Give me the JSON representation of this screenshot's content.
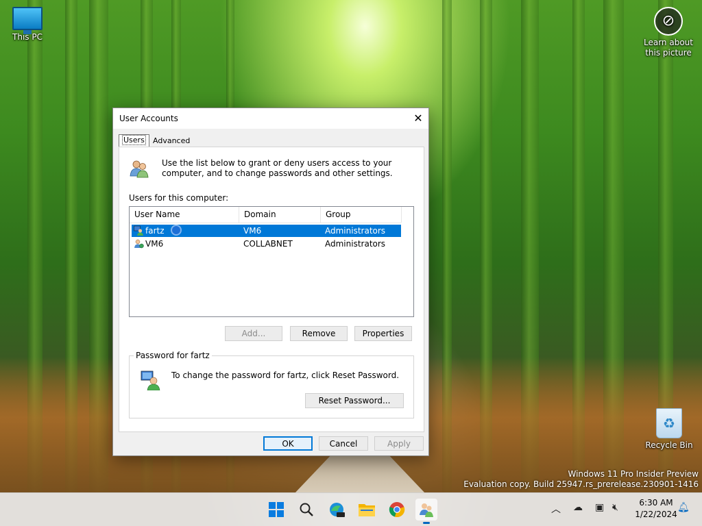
{
  "desktop": {
    "icons": [
      {
        "label": "This PC"
      },
      {
        "label": "Learn about this picture"
      },
      {
        "label": "Recycle Bin"
      }
    ],
    "watermark": {
      "line1": "Windows 11 Pro Insider Preview",
      "line2": "Evaluation copy. Build 25947.rs_prerelease.230901-1416"
    }
  },
  "dialog": {
    "title": "User Accounts",
    "close_glyph": "✕",
    "tabs": [
      {
        "label": "Users",
        "selected": true
      },
      {
        "label": "Advanced",
        "selected": false
      }
    ],
    "info_text": "Use the list below to grant or deny users access to your computer, and to change passwords and other settings.",
    "users_label": "Users for this computer:",
    "columns": [
      "User Name",
      "Domain",
      "Group"
    ],
    "rows": [
      {
        "user": "fartz",
        "domain": "VM6",
        "group": "Administrators",
        "selected": true
      },
      {
        "user": "VM6",
        "domain": "COLLABNET",
        "group": "Administrators",
        "selected": false
      }
    ],
    "buttons": {
      "add": "Add...",
      "remove": "Remove",
      "properties": "Properties",
      "reset_password": "Reset Password...",
      "ok": "OK",
      "cancel": "Cancel",
      "apply": "Apply"
    },
    "password_group": {
      "legend": "Password for fartz",
      "text": "To change the password for fartz, click Reset Password."
    }
  },
  "taskbar": {
    "time": "6:30 AM",
    "date": "1/22/2024",
    "accent": "#0067c0",
    "icons": [
      "windows-start-icon",
      "search-icon",
      "edge-icon",
      "file-explorer-icon",
      "chrome-icon",
      "user-accounts-icon"
    ],
    "tray": [
      "chevron-up-icon",
      "onedrive-icon",
      "network-icon",
      "volume-muted-icon",
      "notification-bell-icon"
    ]
  },
  "colors": {
    "selection": "#0078d7",
    "dialog_bg": "#f0f0f0"
  }
}
